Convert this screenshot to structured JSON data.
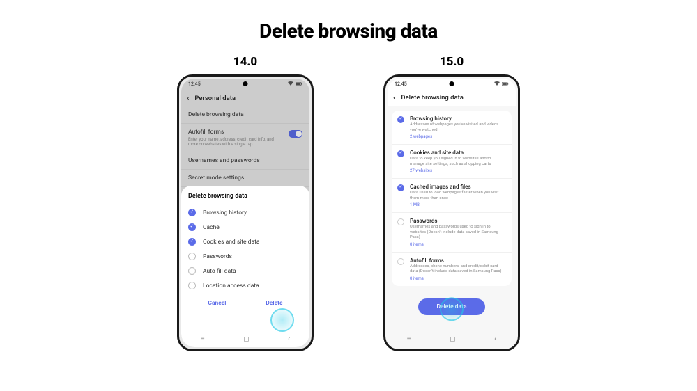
{
  "page_title": "Delete browsing data",
  "v14": {
    "label": "14.0",
    "time": "12:45",
    "appbar_title": "Personal data",
    "bg_items": [
      {
        "title": "Delete browsing data",
        "sub": ""
      },
      {
        "title": "Autofill forms",
        "sub": "Enter your name, address, credit card info, and more on websites with a single tap."
      },
      {
        "title": "Usernames and passwords",
        "sub": ""
      },
      {
        "title": "Secret mode settings",
        "sub": ""
      }
    ],
    "sheet_title": "Delete browsing data",
    "options": [
      {
        "label": "Browsing history",
        "checked": true
      },
      {
        "label": "Cache",
        "checked": true
      },
      {
        "label": "Cookies and site data",
        "checked": true
      },
      {
        "label": "Passwords",
        "checked": false
      },
      {
        "label": "Auto fill data",
        "checked": false
      },
      {
        "label": "Location access data",
        "checked": false
      }
    ],
    "cancel": "Cancel",
    "delete": "Delete"
  },
  "v15": {
    "label": "15.0",
    "time": "12:45",
    "appbar_title": "Delete browsing data",
    "items": [
      {
        "title": "Browsing history",
        "sub": "Addresses of webpages you've visited and videos you've watched",
        "count": "2 webpages",
        "checked": true
      },
      {
        "title": "Cookies and site data",
        "sub": "Data to keep you signed in to websites and to manage site settings, such as shopping carts",
        "count": "27 websites",
        "checked": true
      },
      {
        "title": "Cached images and files",
        "sub": "Data used to load webpages faster when you visit them more than once",
        "count": "1 MB",
        "checked": true
      },
      {
        "title": "Passwords",
        "sub": "Usernames and passwords used to sign in to websites (Doesn't include data saved in Samsung Pass)",
        "count": "0 items",
        "checked": false
      },
      {
        "title": "Autofill forms",
        "sub": "Addresses, phone numbers, and credit/debit card data (Doesn't include data saved in Samsung Pass)",
        "count": "0 items",
        "checked": false
      }
    ],
    "button": "Delete data"
  }
}
